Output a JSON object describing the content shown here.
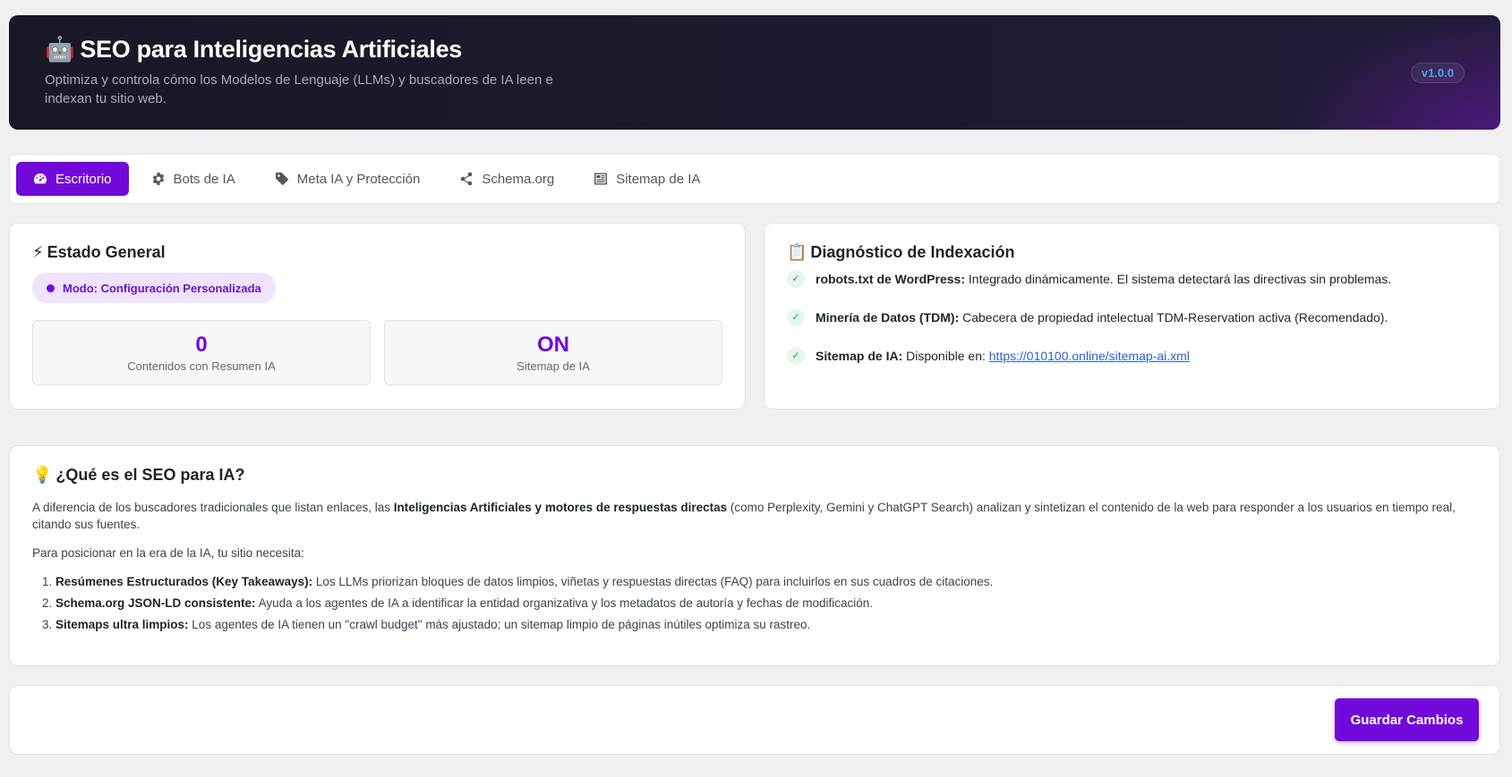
{
  "header": {
    "icon": "robot-icon",
    "title": "SEO para Inteligencias Artificiales",
    "subtitle": "Optimiza y controla cómo los Modelos de Lenguaje (LLMs) y buscadores de IA leen e indexan tu sitio web.",
    "version": "v1.0.0"
  },
  "tabs": [
    {
      "label": "Escritorio",
      "icon": "dashboard-icon",
      "active": true
    },
    {
      "label": "Bots de IA",
      "icon": "gear-icon",
      "active": false
    },
    {
      "label": "Meta IA y Protección",
      "icon": "tag-icon",
      "active": false
    },
    {
      "label": "Schema.org",
      "icon": "share-icon",
      "active": false
    },
    {
      "label": "Sitemap de IA",
      "icon": "sitemap-icon",
      "active": false
    }
  ],
  "estado": {
    "title_icon": "⚡",
    "title": "Estado General",
    "mode": "Modo: Configuración Personalizada",
    "stats": [
      {
        "value": "0",
        "label": "Contenidos con Resumen IA"
      },
      {
        "value": "ON",
        "label": "Sitemap de IA"
      }
    ]
  },
  "diagnostico": {
    "title_icon": "📋",
    "title": "Diagnóstico de Indexación",
    "items": [
      {
        "label": "robots.txt de WordPress:",
        "text": "Integrado dinámicamente. El sistema detectará las directivas sin problemas."
      },
      {
        "label": "Minería de Datos (TDM):",
        "text": "Cabecera de propiedad intelectual TDM-Reservation activa (Recomendado)."
      },
      {
        "label": "Sitemap de IA:",
        "text": "Disponible en:",
        "link": "https://010100.online/sitemap-ai.xml"
      }
    ]
  },
  "info": {
    "title_icon": "💡",
    "title": "¿Qué es el SEO para IA?",
    "p1_a": "A diferencia de los buscadores tradicionales que listan enlaces, las ",
    "p1_b": "Inteligencias Artificiales y motores de respuestas directas",
    "p1_c": " (como Perplexity, Gemini y ChatGPT Search) analizan y sintetizan el contenido de la web para responder a los usuarios en tiempo real, citando sus fuentes.",
    "p2": "Para posicionar en la era de la IA, tu sitio necesita:",
    "list": [
      {
        "label": "Resúmenes Estructurados (Key Takeaways):",
        "text": " Los LLMs priorizan bloques de datos limpios, viñetas y respuestas directas (FAQ) para incluirlos en sus cuadros de citaciones."
      },
      {
        "label": "Schema.org JSON-LD consistente:",
        "text": " Ayuda a los agentes de IA a identificar la entidad organizativa y los metadatos de autoría y fechas de modificación."
      },
      {
        "label": "Sitemaps ultra limpios:",
        "text": " Los agentes de IA tienen un \"crawl budget\" más ajustado; un sitemap limpio de páginas inútiles optimiza su rastreo."
      }
    ]
  },
  "save_label": "Guardar Cambios",
  "colors": {
    "accent": "#7209db",
    "header_bg": "#1b1a2b",
    "link": "#2c5fd6",
    "check": "#1a9e55"
  }
}
